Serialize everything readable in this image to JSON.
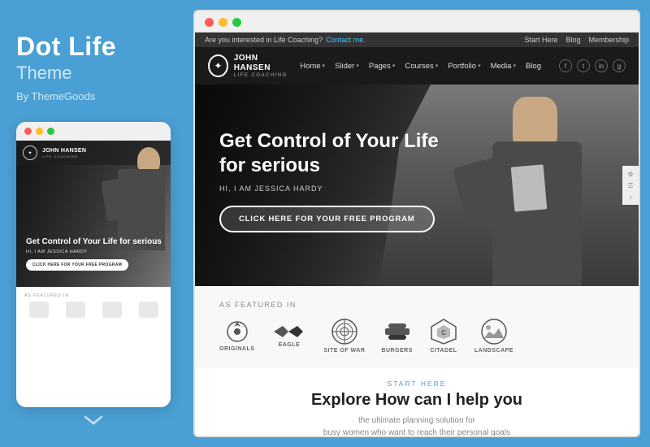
{
  "left": {
    "title": "Dot Life",
    "subtitle": "Theme",
    "author": "By ThemeGoods",
    "dots": [
      {
        "color": "#ff5f57"
      },
      {
        "color": "#febc2e"
      },
      {
        "color": "#28c840"
      }
    ],
    "mini": {
      "nav_name": "JOHN HANSEN",
      "nav_sub": "LIFE COACHING",
      "hero_heading": "Get Control of Your Life for serious",
      "hero_sub": "HI, I AM JESSICA HARDY",
      "hero_btn": "CLICK HERE FOR YOUR FREE PROGRAM",
      "featured_label": "AS FEATURED IN"
    }
  },
  "right": {
    "browser_dots": [
      {
        "color": "#ccc"
      },
      {
        "color": "#ccc"
      },
      {
        "color": "#ccc"
      }
    ],
    "topbar": {
      "text": "Are you interested in Life Coaching?",
      "link_text": "Contact me.",
      "right_items": [
        "Start Here",
        "Blog",
        "Membership"
      ]
    },
    "nav": {
      "logo_name": "JOHN HANSEN",
      "logo_sub": "LIFE COACHING",
      "items": [
        "Home",
        "Slider",
        "Pages",
        "Courses",
        "Portfolio",
        "Media",
        "Blog"
      ],
      "social": [
        "f",
        "t",
        "in",
        "g+"
      ]
    },
    "hero": {
      "heading": "Get Control of Your Life for serious",
      "sub_label": "HI, I AM JESSICA HARDY",
      "btn_label": "CLICK HERE FOR YOUR FREE PROGRAM"
    },
    "featured": {
      "label": "AS FEATURED IN",
      "brands": [
        {
          "icon": "◉",
          "name": "ORIGINALS"
        },
        {
          "icon": "≈",
          "name": "EAGLE"
        },
        {
          "icon": "◎",
          "name": "SITE OF WAR"
        },
        {
          "icon": "⬡",
          "name": "BURGERS"
        },
        {
          "icon": "⬢",
          "name": "CITADEL"
        },
        {
          "icon": "◈",
          "name": "LANDSCAPE"
        }
      ]
    },
    "explore": {
      "start_label": "START HERE",
      "heading": "Explore How can I help you",
      "sub1": "the ultimate planning solution for",
      "sub2": "busy women who want to reach their personal goals"
    },
    "sidebar_icons": [
      "⚙",
      "☰",
      "↕"
    ]
  }
}
